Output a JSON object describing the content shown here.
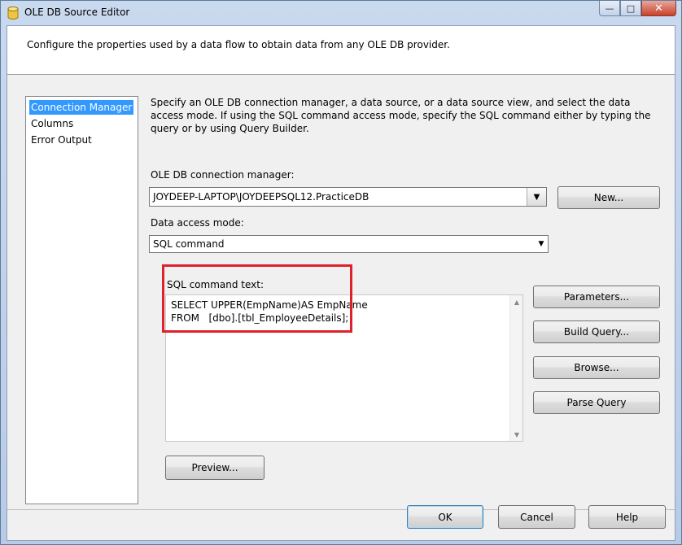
{
  "window": {
    "title": "OLE DB Source Editor",
    "minimize_glyph": "—",
    "maximize_glyph": "□",
    "close_glyph": "✕"
  },
  "header": {
    "description": "Configure the properties used by a data flow to obtain data from any OLE DB provider."
  },
  "nav": {
    "items": [
      {
        "label": "Connection Manager",
        "selected": true
      },
      {
        "label": "Columns",
        "selected": false
      },
      {
        "label": "Error Output",
        "selected": false
      }
    ]
  },
  "main": {
    "instructions": "Specify an OLE DB connection manager, a data source, or a data source view, and select the data access mode. If using the SQL command access mode, specify the SQL command either by typing the query or by using Query Builder.",
    "connection_label": "OLE DB connection manager:",
    "connection_value": "JOYDEEP-LAPTOP\\JOYDEEPSQL12.PracticeDB",
    "new_button": "New...",
    "access_mode_label": "Data access mode:",
    "access_mode_value": "SQL command",
    "sql_label": "SQL command text:",
    "sql_text": "SELECT UPPER(EmpName)AS EmpName\nFROM   [dbo].[tbl_EmployeeDetails];",
    "parameters_button": "Parameters...",
    "build_query_button": "Build Query...",
    "browse_button": "Browse...",
    "parse_query_button": "Parse Query",
    "preview_button": "Preview..."
  },
  "footer": {
    "ok_button": "OK",
    "cancel_button": "Cancel",
    "help_button": "Help"
  },
  "colors": {
    "selection": "#3399ff",
    "highlight_box": "#e0202a"
  },
  "icons": {
    "app": "database-cylinder-icon",
    "dropdown": "chevron-down-icon"
  }
}
